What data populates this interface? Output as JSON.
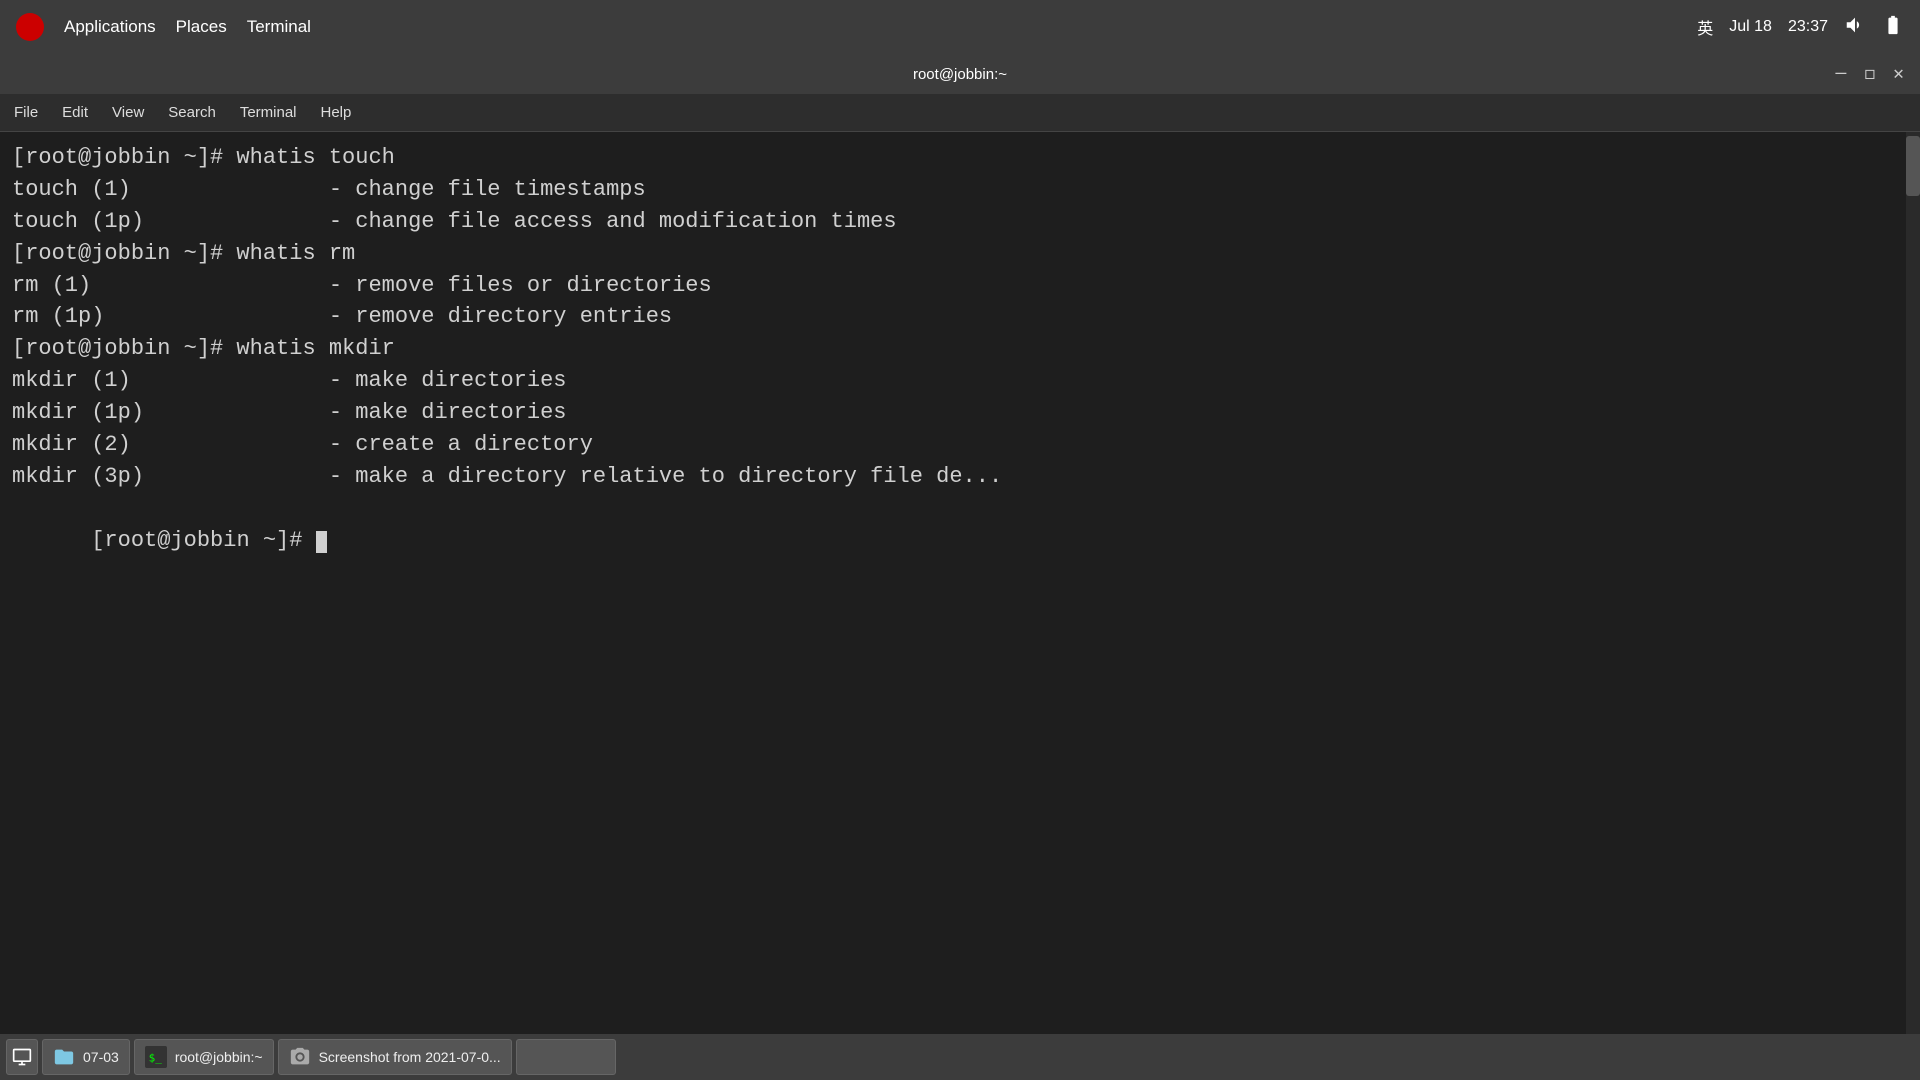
{
  "system_bar": {
    "app_menu": "Applications",
    "places_menu": "Places",
    "terminal_menu": "Terminal",
    "lang": "英",
    "date": "Jul 18",
    "time": "23:37",
    "volume_icon": "volume",
    "battery_icon": "battery"
  },
  "window": {
    "title": "root@jobbin:~",
    "minimize_label": "—",
    "maximize_label": "◻",
    "close_label": "✕"
  },
  "menu_bar": {
    "file": "File",
    "edit": "Edit",
    "view": "View",
    "search": "Search",
    "terminal": "Terminal",
    "help": "Help"
  },
  "terminal": {
    "lines": [
      "[root@jobbin ~]# whatis touch",
      "touch (1)               - change file timestamps",
      "touch (1p)              - change file access and modification times",
      "[root@jobbin ~]# whatis rm",
      "rm (1)                  - remove files or directories",
      "rm (1p)                 - remove directory entries",
      "[root@jobbin ~]# whatis mkdir",
      "mkdir (1)               - make directories",
      "mkdir (1p)              - make directories",
      "mkdir (2)               - create a directory",
      "mkdir (3p)              - make a directory relative to directory file de...",
      "[root@jobbin ~]# "
    ]
  },
  "taskbar": {
    "show_desktop_label": "show desktop",
    "btn1_label": "07-03",
    "btn2_label": "root@jobbin:~",
    "btn3_label": "Screenshot from 2021-07-0..."
  }
}
